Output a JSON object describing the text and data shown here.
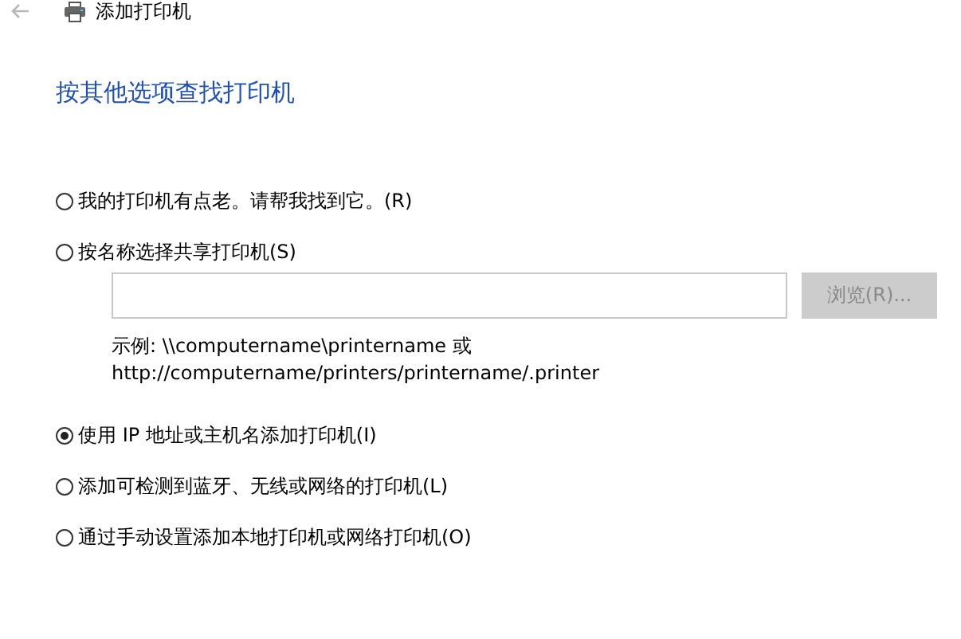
{
  "window": {
    "title": "添加打印机"
  },
  "heading": "按其他选项查找打印机",
  "options": [
    {
      "label": "我的打印机有点老。请帮我找到它。(R)",
      "selected": false
    },
    {
      "label": "按名称选择共享打印机(S)",
      "selected": false,
      "share": {
        "browse_button": {
          "label": "浏览(R)...",
          "disabled": true
        },
        "example_lines": [
          "示例: \\\\computername\\printername 或",
          "http://computername/printers/printername/.printer"
        ]
      }
    },
    {
      "label": "使用 IP 地址或主机名添加打印机(I)",
      "selected": true
    },
    {
      "label": "添加可检测到蓝牙、无线或网络的打印机(L)",
      "selected": false
    },
    {
      "label": "通过手动设置添加本地打印机或网络打印机(O)",
      "selected": false
    }
  ]
}
